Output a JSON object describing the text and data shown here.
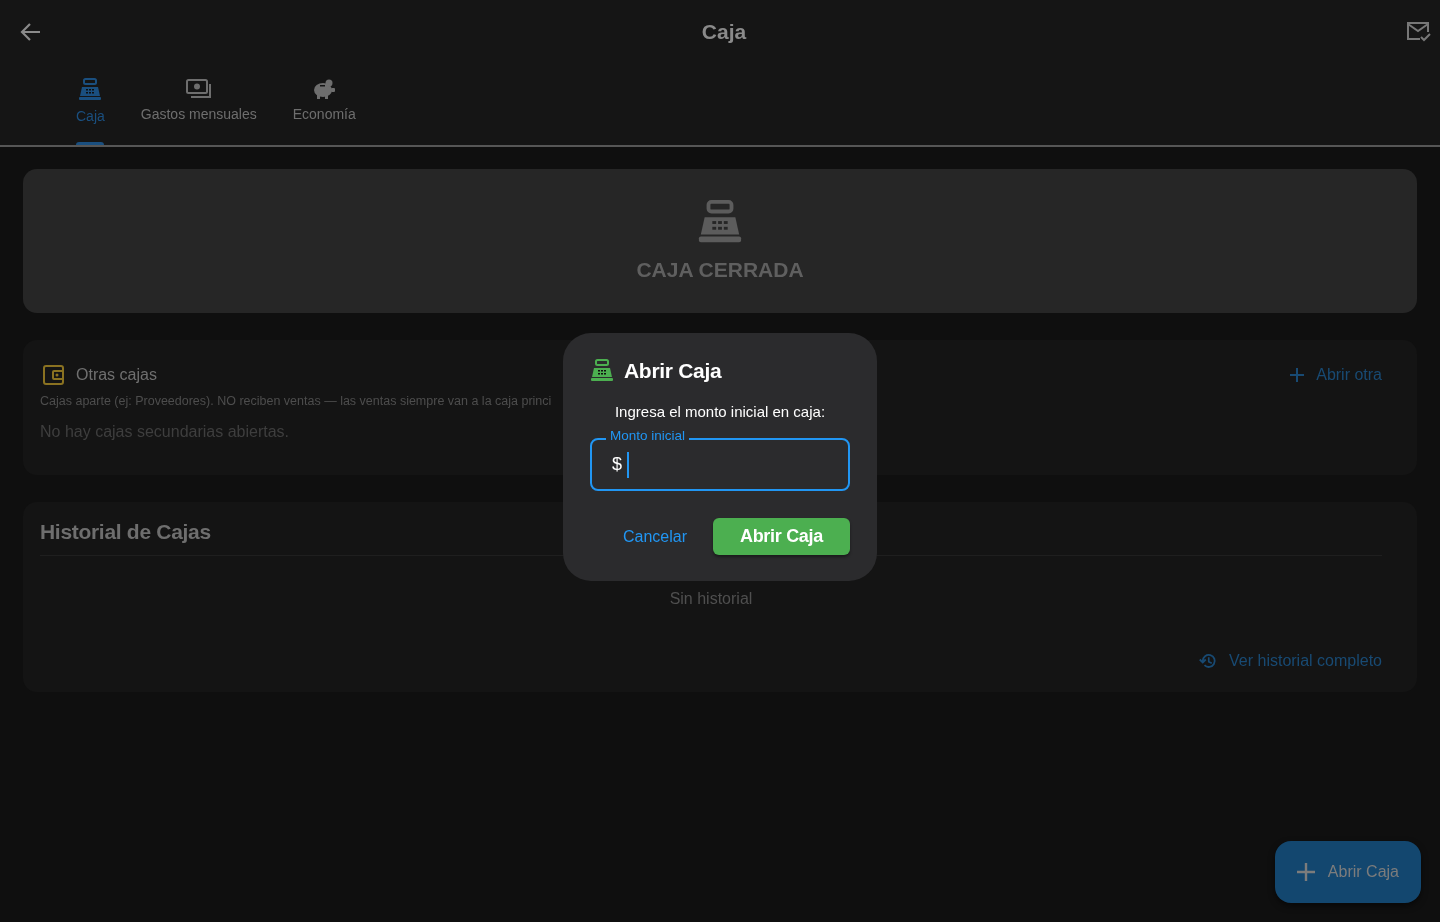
{
  "app_bar": {
    "title": "Caja"
  },
  "tabs": [
    {
      "label": "Caja",
      "selected": true
    },
    {
      "label": "Gastos mensuales",
      "selected": false
    },
    {
      "label": "Economía",
      "selected": false
    }
  ],
  "status_card": {
    "label": "CAJA CERRADA"
  },
  "other_registers": {
    "title": "Otras cajas",
    "description": "Cajas aparte (ej: Proveedores). NO reciben ventas — las ventas siempre van a la caja princi",
    "action": "Abrir otra",
    "empty_text": "No hay cajas secundarias abiertas."
  },
  "history": {
    "title": "Historial de Cajas",
    "empty_text": "Sin historial",
    "action": "Ver historial completo"
  },
  "fab": {
    "label": "Abrir Caja"
  },
  "dialog": {
    "title": "Abrir Caja",
    "prompt": "Ingresa el monto inicial en caja:",
    "field": {
      "label": "Monto inicial",
      "prefix": "$",
      "focused": true
    },
    "buttons": [
      {
        "label": "Cancelar",
        "kind": "text"
      },
      {
        "label": "Abrir Caja",
        "kind": "filled"
      }
    ]
  }
}
